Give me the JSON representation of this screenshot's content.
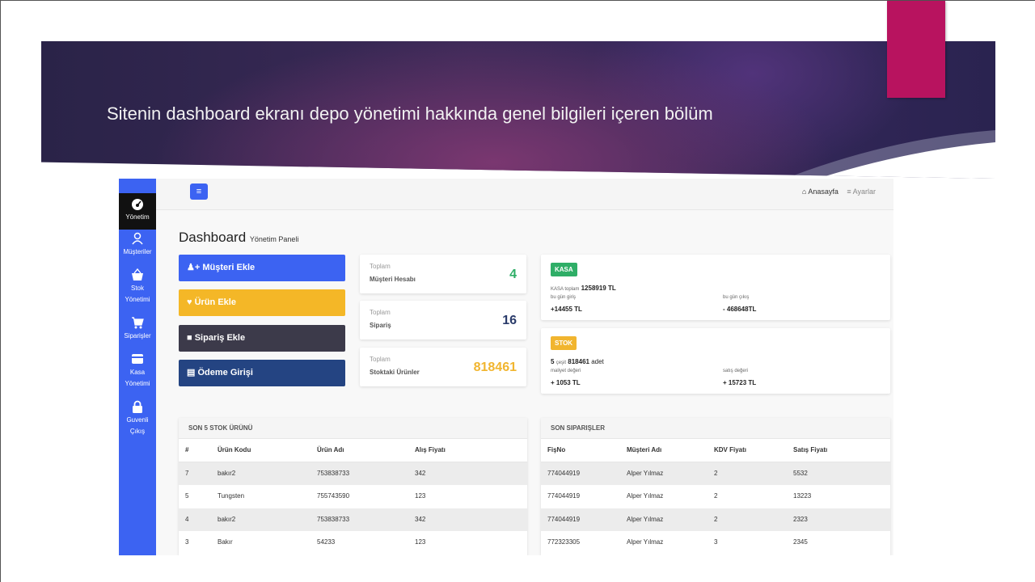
{
  "slide": {
    "title": "Sitenin dashboard ekranı depo yönetimi hakkında genel bilgileri içeren bölüm"
  },
  "sidebar": {
    "items": [
      {
        "label": "Yönetim",
        "icon": "dashboard-icon"
      },
      {
        "label": "Müşteriler",
        "icon": "user-icon"
      },
      {
        "label1": "Stok",
        "label2": "Yönetimi",
        "icon": "basket-icon"
      },
      {
        "label": "Siparişler",
        "icon": "cart-icon"
      },
      {
        "label1": "Kasa",
        "label2": "Yönetimi",
        "icon": "credit-card-icon"
      },
      {
        "label1": "Guvenli",
        "label2": "Çıkış",
        "icon": "lock-icon"
      }
    ]
  },
  "topbar": {
    "menu_icon": "≡",
    "home_label": "Anasayfa",
    "settings_label": "Ayarlar"
  },
  "page": {
    "title": "Dashboard",
    "subtitle": "Yönetim Paneli"
  },
  "actions": [
    {
      "label": "Müşteri Ekle",
      "color": "#3c63f2",
      "icon": "user-plus-icon"
    },
    {
      "label": "Ürün Ekle",
      "color": "#f4b727",
      "icon": "basket-icon"
    },
    {
      "label": "Sipariş Ekle",
      "color": "#3c3a4a",
      "icon": "cart-icon"
    },
    {
      "label": "Ödeme Girişi",
      "color": "#244482",
      "icon": "credit-card-icon"
    }
  ],
  "stats": [
    {
      "top": "Toplam",
      "label": "Müşteri Hesabı",
      "value": "4",
      "color": "#2fae67"
    },
    {
      "top": "Toplam",
      "label": "Sipariş",
      "value": "16",
      "color": "#2a3b6a"
    },
    {
      "top": "Toplam",
      "label": "Stoktaki Ürünler",
      "value": "818461",
      "color": "#f1b52f"
    }
  ],
  "kasa": {
    "badge": "KASA",
    "total_prefix": "KASA toplam",
    "total_value": "1258919 TL",
    "in_label": "bu gün giriş",
    "in_value": "+14455 TL",
    "out_label": "bu gün çıkış",
    "out_value": "- 468648TL"
  },
  "stok": {
    "badge": "STOK",
    "count": "5",
    "count_label": "çeşit",
    "amount": "818461",
    "amount_suffix": "adet",
    "cost_label": "maliyet değeri",
    "cost_value": "+ 1053 TL",
    "sale_label": "satış değeri",
    "sale_value": "+ 15723 TL"
  },
  "stock_table": {
    "title": "SON 5 STOK ÜRÜNÜ",
    "columns": [
      "#",
      "Ürün Kodu",
      "Ürün Adı",
      "Alış Fiyatı"
    ],
    "rows": [
      [
        "7",
        "bakır2",
        "753838733",
        "342"
      ],
      [
        "5",
        "Tungsten",
        "755743590",
        "123"
      ],
      [
        "4",
        "bakır2",
        "753838733",
        "342"
      ],
      [
        "3",
        "Bakır",
        "54233",
        "123"
      ]
    ]
  },
  "orders_table": {
    "title": "SON SIPARIŞLER",
    "columns": [
      "FişNo",
      "Müşteri Adı",
      "KDV Fiyatı",
      "Satış Fiyatı"
    ],
    "rows": [
      [
        "774044919",
        "Alper Yılmaz",
        "2",
        "5532"
      ],
      [
        "774044919",
        "Alper Yılmaz",
        "2",
        "13223"
      ],
      [
        "774044919",
        "Alper Yılmaz",
        "2",
        "2323"
      ],
      [
        "772323305",
        "Alper Yılmaz",
        "3",
        "2345"
      ]
    ]
  }
}
